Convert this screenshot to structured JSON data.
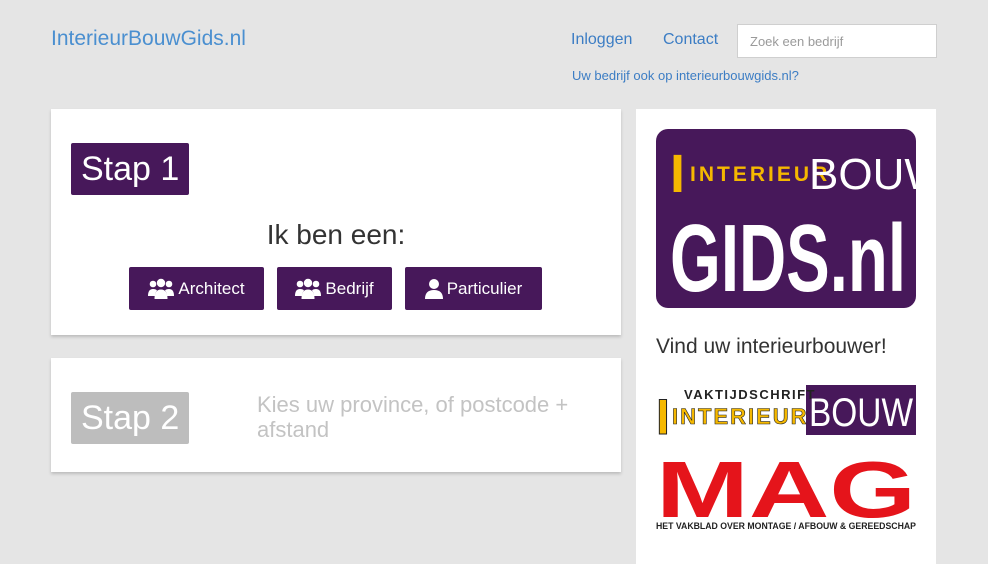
{
  "header": {
    "site_title": "InterieurBouwGids.nl",
    "nav": {
      "login": "Inloggen",
      "contact": "Contact"
    },
    "search_placeholder": "Zoek een bedrijf",
    "promo_link": "Uw bedrijf ook op interieurbouwgids.nl?"
  },
  "step1": {
    "badge": "Stap 1",
    "heading": "Ik ben een:",
    "buttons": [
      {
        "label": "Architect",
        "icon": "group-icon"
      },
      {
        "label": "Bedrijf",
        "icon": "group-icon"
      },
      {
        "label": "Particulier",
        "icon": "user-icon"
      }
    ]
  },
  "step2": {
    "badge": "Stap 2",
    "text": "Kies uw province, of postcode + afstand"
  },
  "sidebar": {
    "logo_main": {
      "line1": "INTERIEUR",
      "line1_bouw": "BOUW",
      "line2": "GIDS.nl"
    },
    "heading": "Vind uw interieurbouwer!",
    "logo_vak": {
      "top": "VAKTIJDSCHRIFT",
      "main": "INTERIEUR",
      "bouw": "BOUW"
    },
    "logo_mag": {
      "main": "MAG",
      "tagline": "HET VAKBLAD OVER MONTAGE / AFBOUW & GEREEDSCHAP"
    }
  },
  "colors": {
    "brand_purple": "#47185a",
    "brand_yellow": "#f5b800",
    "link_blue": "#3c7dc4",
    "mag_red": "#e5141b",
    "inactive_grey": "#bdbdbd"
  }
}
